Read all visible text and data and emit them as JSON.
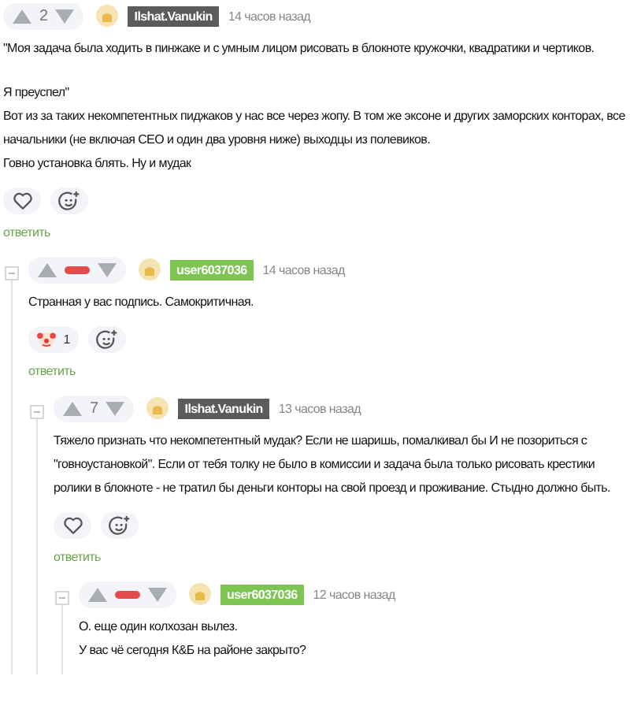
{
  "comments": [
    {
      "vote": {
        "kind": "score",
        "value": "2"
      },
      "author": {
        "name": "Ilshat.Vanukin",
        "color": "#5b5b5b"
      },
      "time": "14 часов назад",
      "paragraphs": [
        [
          "\"Моя задача была ходить в пинжаке и с умным лицом рисовать в блокноте кружочки, квадратики и чертиков."
        ],
        [
          "Я преуспел\"",
          "Вот из за таких некомпетентных пиджаков у нас все через жопу. В том же эксоне и других заморских конторах, все начальники (не включая CEO и один два уровня ниже) выходцы из полевиков.",
          "Говно установка блять. Ну и мудак"
        ]
      ],
      "reactions": [
        {
          "kind": "like"
        },
        {
          "kind": "add-emoji"
        }
      ],
      "reply": "ответить",
      "children": [
        {
          "vote": {
            "kind": "negative"
          },
          "author": {
            "name": "user6037036",
            "color": "#7dc452"
          },
          "time": "14 часов назад",
          "paragraphs": [
            [
              "Странная у вас подпись. Самокритичная."
            ]
          ],
          "reactions": [
            {
              "kind": "clown",
              "count": "1"
            },
            {
              "kind": "add-emoji"
            }
          ],
          "reply": "ответить",
          "children": [
            {
              "vote": {
                "kind": "score",
                "value": "7"
              },
              "author": {
                "name": "Ilshat.Vanukin",
                "color": "#5b5b5b"
              },
              "time": "13 часов назад",
              "paragraphs": [
                [
                  "Тяжело признать что некомпетентный мудак? Если не шаришь, помалкивал бы И не позориться с \"говноустановкой\". Если от тебя толку не было в комиссии и задача была только рисовать крестики ролики в блокноте - не тратил бы деньги конторы на свой проезд и проживание. Стыдно должно быть."
                ]
              ],
              "reactions": [
                {
                  "kind": "like"
                },
                {
                  "kind": "add-emoji"
                }
              ],
              "reply": "ответить",
              "children": [
                {
                  "vote": {
                    "kind": "negative"
                  },
                  "author": {
                    "name": "user6037036",
                    "color": "#7dc452"
                  },
                  "time": "12 часов назад",
                  "paragraphs": [
                    [
                      "О. еще один колхозан вылез.",
                      "У вас чё сегодня К&Б на районе закрыто?"
                    ]
                  ]
                }
              ]
            }
          ]
        }
      ]
    }
  ]
}
